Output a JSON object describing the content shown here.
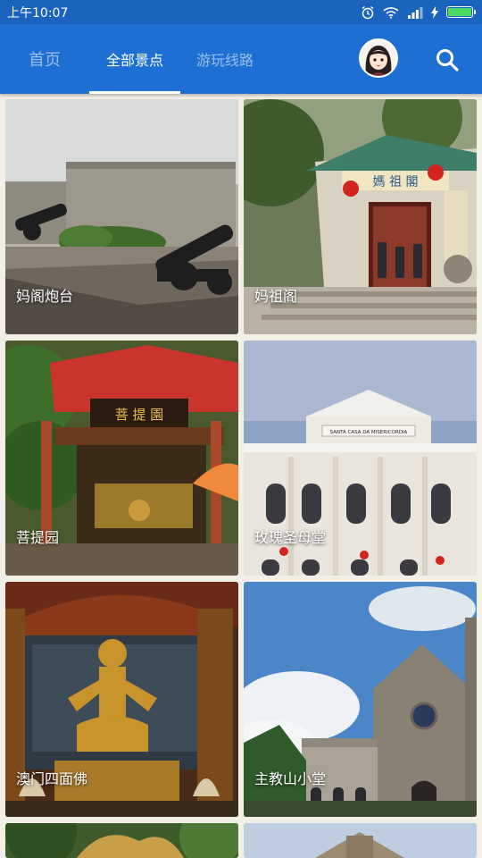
{
  "status": {
    "time": "上午10:07"
  },
  "tabs": [
    {
      "label": "首页"
    },
    {
      "label": "全部景点"
    },
    {
      "label": "游玩线路"
    }
  ],
  "cards": [
    {
      "label": "妈阁炮台"
    },
    {
      "label": "妈祖阁"
    },
    {
      "label": "菩提园"
    },
    {
      "label": "玫瑰圣母堂"
    },
    {
      "label": "澳门四面佛"
    },
    {
      "label": "主教山小堂"
    }
  ],
  "signs": {
    "mazu_plaque": "媽 祖 閣",
    "puti_plaque": "菩 提 園",
    "rosary_plaque": "SANTA CASA DA MISERICORDIA"
  },
  "colors": {
    "statusbar": "#1a63bf",
    "appbar": "#1e6fd3",
    "background": "#f2efe7"
  },
  "icons": [
    "alarm-icon",
    "wifi-icon",
    "signal-icon",
    "charging-icon",
    "battery-icon",
    "search-icon"
  ]
}
